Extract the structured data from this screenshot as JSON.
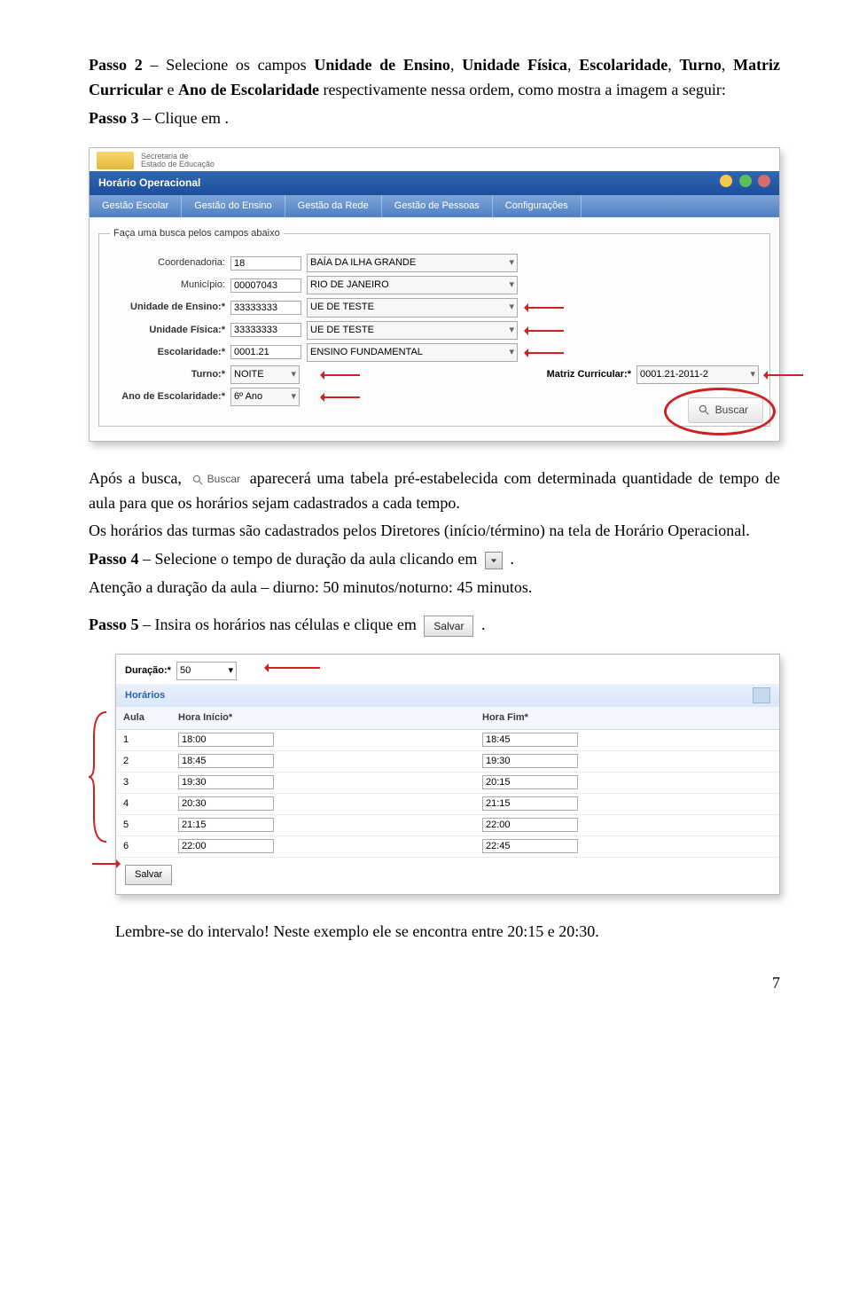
{
  "step2": {
    "label": "Passo 2",
    "text_a": " – Selecione os campos ",
    "f1": "Unidade de Ensino",
    "sep1": ", ",
    "f2": "Unidade Física",
    "sep2": ", ",
    "f3": "Escolaridade",
    "sep3": ", ",
    "f4": "Turno",
    "sep4": ", ",
    "f5": "Matriz Curricular",
    "text_e": " e ",
    "f6": "Ano de Escolaridade",
    "text_b": " respectivamente nessa ordem, como mostra a imagem a seguir:"
  },
  "step3": {
    "label": "Passo 3",
    "text": " – Clique em ."
  },
  "shot1": {
    "header_sub1": "Secretaria de",
    "header_sub2": "Estado de Educação",
    "title": "Horário Operacional",
    "menu": [
      "Gestão Escolar",
      "Gestão do Ensino",
      "Gestão da Rede",
      "Gestão de Pessoas",
      "Configurações"
    ],
    "legend": "Faça uma busca pelos campos abaixo",
    "rows": {
      "coord_label": "Coordenadoria:",
      "coord_code": "18",
      "coord_val": "BAÍA DA ILHA GRANDE",
      "mun_label": "Município:",
      "mun_code": "00007043",
      "mun_val": "RIO DE JANEIRO",
      "ue_label": "Unidade de Ensino:*",
      "ue_code": "33333333",
      "ue_val": "UE DE TESTE",
      "uf_label": "Unidade Física:*",
      "uf_code": "33333333",
      "uf_val": "UE DE TESTE",
      "esc_label": "Escolaridade:*",
      "esc_code": "0001.21",
      "esc_val": "ENSINO FUNDAMENTAL",
      "turno_label": "Turno:*",
      "turno_val": "NOITE",
      "matriz_label": "Matriz Curricular:*",
      "matriz_val": "0001.21-2011-2",
      "ano_label": "Ano de Escolaridade:*",
      "ano_val": "6º Ano"
    },
    "buscar": "Buscar"
  },
  "after_busca": {
    "a": "Após a busca, ",
    "inline_label": "Buscar",
    "b": " aparecerá uma tabela pré-estabelecida com determinada quantidade de tempo de aula para que os horários sejam cadastrados a cada tempo.",
    "c": "Os horários das turmas são cadastrados pelos Diretores (início/término) na tela de Horário Operacional."
  },
  "step4": {
    "label": "Passo 4",
    "text_a": " – Selecione o tempo de duração da aula clicando em ",
    "text_b": " .",
    "attention": "Atenção a duração da aula – diurno: 50 minutos/noturno: 45 minutos."
  },
  "step5": {
    "label": "Passo 5",
    "text_a": " – Insira os horários nas células e clique em ",
    "salvar": "Salvar",
    "text_b": " ."
  },
  "shot2": {
    "dur_label": "Duração:*",
    "dur_val": "50",
    "section": "Horários",
    "th_aula": "Aula",
    "th_ini": "Hora Início*",
    "th_fim": "Hora Fim*",
    "rows": [
      {
        "n": "1",
        "ini": "18:00",
        "fim": "18:45"
      },
      {
        "n": "2",
        "ini": "18:45",
        "fim": "19:30"
      },
      {
        "n": "3",
        "ini": "19:30",
        "fim": "20:15"
      },
      {
        "n": "4",
        "ini": "20:30",
        "fim": "21:15"
      },
      {
        "n": "5",
        "ini": "21:15",
        "fim": "22:00"
      },
      {
        "n": "6",
        "ini": "22:00",
        "fim": "22:45"
      }
    ],
    "salvar": "Salvar"
  },
  "lembre": "Lembre-se do intervalo! Neste exemplo ele se encontra entre 20:15 e 20:30.",
  "page": "7"
}
